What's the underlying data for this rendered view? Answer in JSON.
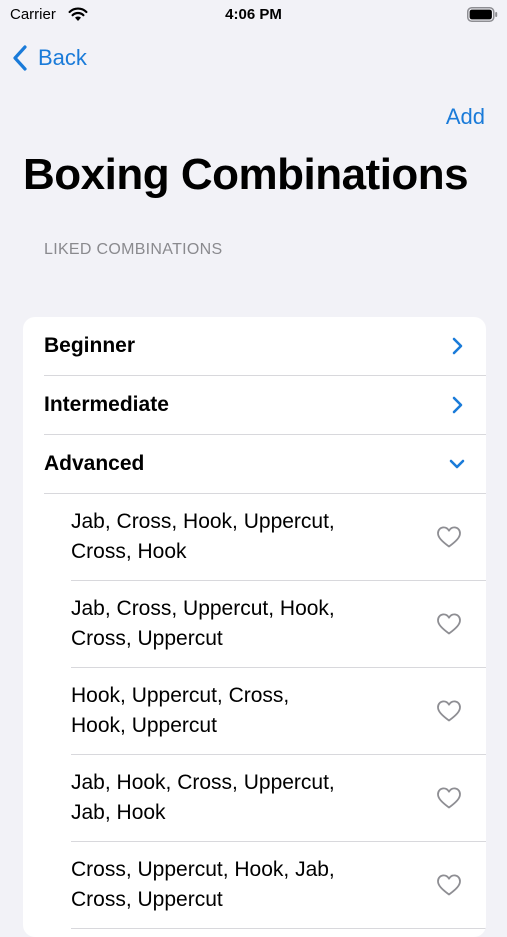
{
  "status_bar": {
    "carrier": "Carrier",
    "time": "4:06 PM"
  },
  "nav": {
    "back_label": "Back",
    "add_label": "Add"
  },
  "page": {
    "title": "Boxing Combinations",
    "section_header": "LIKED COMBINATIONS"
  },
  "groups": [
    {
      "label": "Beginner",
      "expanded": false
    },
    {
      "label": "Intermediate",
      "expanded": false
    },
    {
      "label": "Advanced",
      "expanded": true
    }
  ],
  "combinations": [
    {
      "line1": "Jab, Cross, Hook, Uppercut,",
      "line2": "Cross, Hook",
      "liked": false
    },
    {
      "line1": "Jab, Cross, Uppercut, Hook,",
      "line2": "Cross, Uppercut",
      "liked": false
    },
    {
      "line1": "Hook, Uppercut, Cross,",
      "line2": "Hook, Uppercut",
      "liked": false
    },
    {
      "line1": "Jab, Hook, Cross, Uppercut,",
      "line2": "Jab, Hook",
      "liked": false
    },
    {
      "line1": "Cross, Uppercut, Hook, Jab,",
      "line2": "Cross, Uppercut",
      "liked": false
    }
  ],
  "colors": {
    "accent": "#1a7bd9",
    "background": "#f2f2f7",
    "secondary_text": "#8a8a8e"
  },
  "icons": {
    "back": "chevron-left-icon",
    "collapsed": "chevron-right-icon",
    "expanded": "chevron-down-icon",
    "like": "heart-outline-icon"
  }
}
